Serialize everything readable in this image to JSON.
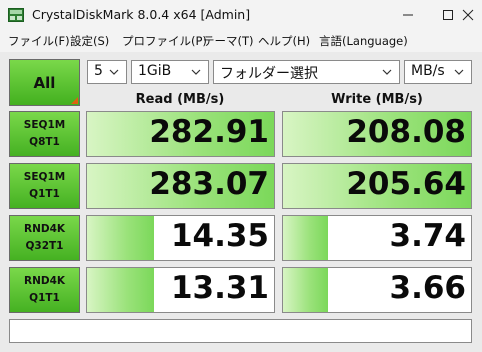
{
  "window": {
    "title": "CrystalDiskMark 8.0.4 x64 [Admin]"
  },
  "menu": [
    "ファイル(F)",
    "設定(S)",
    "プロファイル(P)",
    "テーマ(T)",
    "ヘルプ(H)",
    "言語(Language)"
  ],
  "controls": {
    "all_label": "All",
    "count": "5",
    "size": "1GiB",
    "drive": "フォルダー選択",
    "unit": "MB/s"
  },
  "headers": {
    "read": "Read (MB/s)",
    "write": "Write (MB/s)"
  },
  "rows": [
    {
      "line1": "SEQ1M",
      "line2": "Q8T1",
      "read": "282.91",
      "write": "208.08",
      "read_fill": 1.0,
      "write_fill": 1.0
    },
    {
      "line1": "SEQ1M",
      "line2": "Q1T1",
      "read": "283.07",
      "write": "205.64",
      "read_fill": 1.0,
      "write_fill": 1.0
    },
    {
      "line1": "RND4K",
      "line2": "Q32T1",
      "read": "14.35",
      "write": "3.74",
      "read_fill": 0.36,
      "write_fill": 0.24
    },
    {
      "line1": "RND4K",
      "line2": "Q1T1",
      "read": "13.31",
      "write": "3.66",
      "read_fill": 0.36,
      "write_fill": 0.24
    }
  ],
  "status": "",
  "colors": {
    "accent_green": "#45b122",
    "fill_green": "#7bd85a",
    "corner_orange": "#e06010"
  }
}
